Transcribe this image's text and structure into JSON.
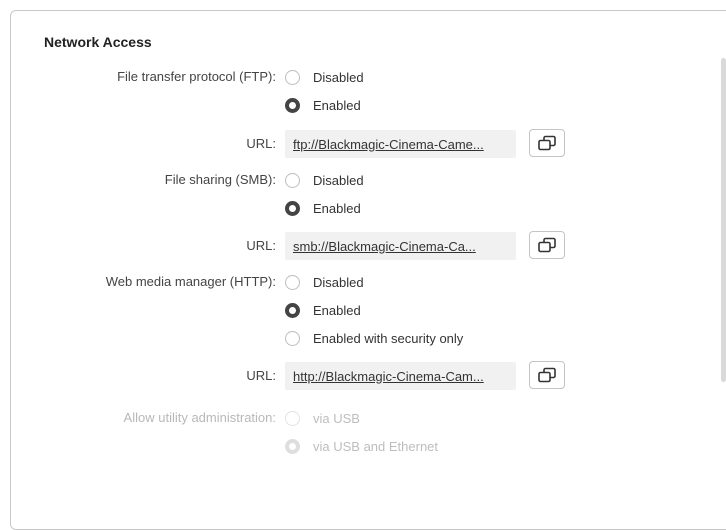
{
  "section": {
    "title": "Network Access"
  },
  "ftp": {
    "label": "File transfer protocol (FTP):",
    "options": [
      "Disabled",
      "Enabled"
    ],
    "selected": "Enabled",
    "url_label": "URL:",
    "url": "ftp://Blackmagic-Cinema-Came..."
  },
  "smb": {
    "label": "File sharing (SMB):",
    "options": [
      "Disabled",
      "Enabled"
    ],
    "selected": "Enabled",
    "url_label": "URL:",
    "url": "smb://Blackmagic-Cinema-Ca..."
  },
  "http": {
    "label": "Web media manager (HTTP):",
    "options": [
      "Disabled",
      "Enabled",
      "Enabled with security only"
    ],
    "selected": "Enabled",
    "url_label": "URL:",
    "url": "http://Blackmagic-Cinema-Cam..."
  },
  "utility": {
    "label": "Allow utility administration:",
    "options": [
      "via USB",
      "via USB and Ethernet"
    ],
    "selected": "via USB and Ethernet",
    "disabled": true
  },
  "icons": {
    "copy": "copy-icon"
  },
  "colors": {
    "panel_border": "#c9c9c9",
    "selected_radio": "#444444",
    "url_background": "#f1f1f1",
    "disabled_text": "#b8b8b8"
  }
}
